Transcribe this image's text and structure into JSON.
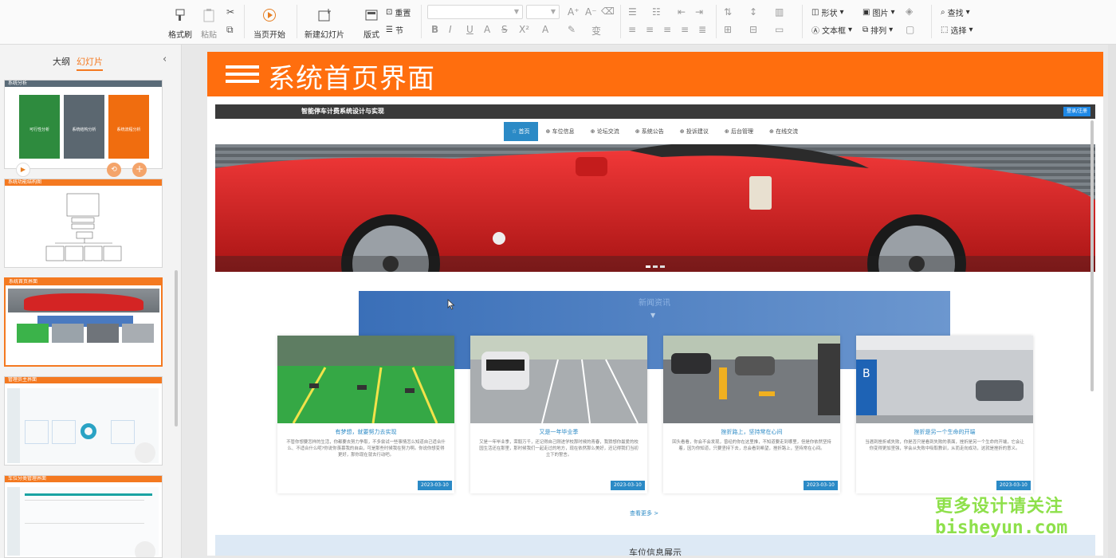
{
  "ribbon": {
    "format_painter": "格式刷",
    "paste": "粘贴",
    "slideshow": "当页开始",
    "new_slide": "新建幻灯片",
    "layout": "版式",
    "reset": "重置",
    "section": "节",
    "shape": "形状",
    "picture": "图片",
    "textbox": "文本框",
    "arrange": "排列",
    "find": "查找",
    "select": "选择"
  },
  "panel": {
    "tab_outline": "大纲",
    "tab_slides": "幻灯片",
    "slides": [
      {
        "title": "系统分析",
        "boxes": [
          "可行性分析",
          "系统结构分析",
          "系统流程分析"
        ]
      },
      {
        "title": "系统功能结构图"
      },
      {
        "title": "系统首页界面"
      },
      {
        "title": "管理员主界面"
      },
      {
        "title": "车位分类管理界面"
      }
    ]
  },
  "slide": {
    "title": "系统首页界面",
    "site": {
      "title": "智能停车计费系统设计与实现",
      "login": "登录/注册",
      "nav": [
        "☆ 首页",
        "⊕ 车位信息",
        "⊕ 论坛交流",
        "⊕ 系统公告",
        "⊕ 投诉建议",
        "⊕ 后台管理",
        "⊕ 在线交流"
      ],
      "section_title": "新闻资讯",
      "cards": [
        {
          "title": "有梦想，就要努力去实现",
          "text": "不管你想要怎样的生活，你都要去努力争取，不多尝试一些事情怎么知道自己适合什么、不适合什么呢?你说你羡慕我的自由，可是那些时候我在努力啊。你说你想变得更好，那你现在就去行动吧。",
          "date": "2023-03-10"
        },
        {
          "title": "又是一年毕业季",
          "text": "又是一年毕业季，荣毅万千，还记得自己刚进学校那时候的青春，我猜想你最爱的校园生活还在那里，那时候我们一起走过的地方，现在依然那么美好，还记得我们当初立下的誓言。",
          "date": "2023-03-10"
        },
        {
          "title": "挫折路上，坚持常在心间",
          "text": "回头看看，你会不会发现，曾经的你在这里推，不知道要走到哪里，但是你依然坚持着，因为你知道，只要坚持下去，总会看到希望，挫折路上，坚持常在心间。",
          "date": "2023-03-10"
        },
        {
          "title": "挫折是另一个生命的开端",
          "text": "当遇到挫折或失败，你是否只是看到失败的表面，挫折是另一个生命的开端，它会让你变得更加坚强，学会从失败中吸取教训，从而走向成功，这就是挫折的意义。",
          "date": "2023-03-10"
        }
      ],
      "more": "查看更多 >",
      "lower_title": "车位信息展示"
    }
  },
  "watermark": {
    "line1": "更多设计请关注",
    "line2": "bisheyun.com"
  },
  "colors": {
    "accent": "#ff6e0e",
    "link": "#2b8ac6"
  }
}
